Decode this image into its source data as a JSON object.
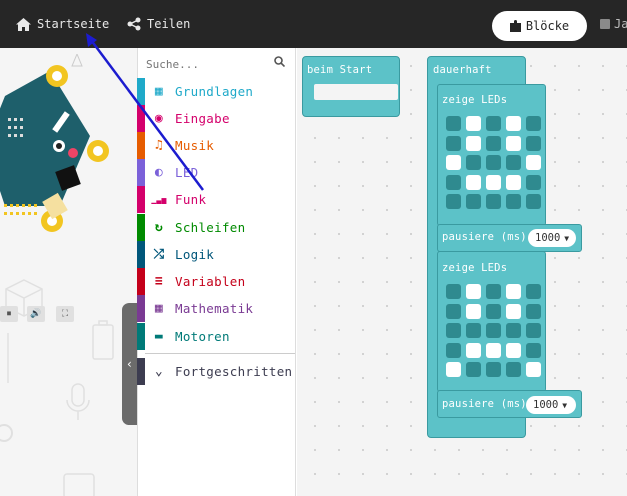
{
  "topbar": {
    "home_label": "Startseite",
    "share_label": "Teilen",
    "blocks_label": "Blöcke",
    "js_label": "Ja"
  },
  "toolbox": {
    "search_placeholder": "Suche...",
    "categories": [
      {
        "label": "Grundlagen",
        "color": "#1fa9c9",
        "icon": "grid-icon"
      },
      {
        "label": "Eingabe",
        "color": "#d4006b",
        "icon": "target-icon"
      },
      {
        "label": "Musik",
        "color": "#e65c00",
        "icon": "headphones-icon"
      },
      {
        "label": "LED",
        "color": "#7b61d9",
        "icon": "toggle-icon"
      },
      {
        "label": "Funk",
        "color": "#d4006b",
        "icon": "signal-bars-icon"
      },
      {
        "label": "Schleifen",
        "color": "#008a00",
        "icon": "refresh-icon"
      },
      {
        "label": "Logik",
        "color": "#00567a",
        "icon": "shuffle-icon"
      },
      {
        "label": "Variablen",
        "color": "#c4001a",
        "icon": "list-icon"
      },
      {
        "label": "Mathematik",
        "color": "#7a3a93",
        "icon": "calculator-icon"
      },
      {
        "label": "Motoren",
        "color": "#007a78",
        "icon": "car-icon"
      },
      {
        "label": "Fortgeschritten",
        "color": "#3c3c50",
        "icon": "chevron-down-icon"
      }
    ]
  },
  "workspace": {
    "on_start_label": "beim Start",
    "forever_label": "dauerhaft",
    "show_leds_label_1": "zeige LEDs",
    "show_leds_label_2": "zeige LEDs",
    "pause_label_1": "pausiere (ms)",
    "pause_label_2": "pausiere (ms)",
    "pause_value_1": "1000",
    "pause_value_2": "1000",
    "leds_1": [
      [
        0,
        1,
        0,
        1,
        0
      ],
      [
        0,
        1,
        0,
        1,
        0
      ],
      [
        1,
        0,
        0,
        0,
        1
      ],
      [
        0,
        1,
        1,
        1,
        0
      ],
      [
        0,
        0,
        0,
        0,
        0
      ]
    ],
    "leds_2": [
      [
        0,
        1,
        0,
        1,
        0
      ],
      [
        0,
        1,
        0,
        1,
        0
      ],
      [
        0,
        0,
        0,
        0,
        0
      ],
      [
        0,
        1,
        1,
        1,
        0
      ],
      [
        1,
        0,
        0,
        0,
        1
      ]
    ]
  },
  "colors": {
    "topbar": "#262626",
    "block": "#5cc2c8",
    "annotation_arrow": "#1c1ccf"
  }
}
